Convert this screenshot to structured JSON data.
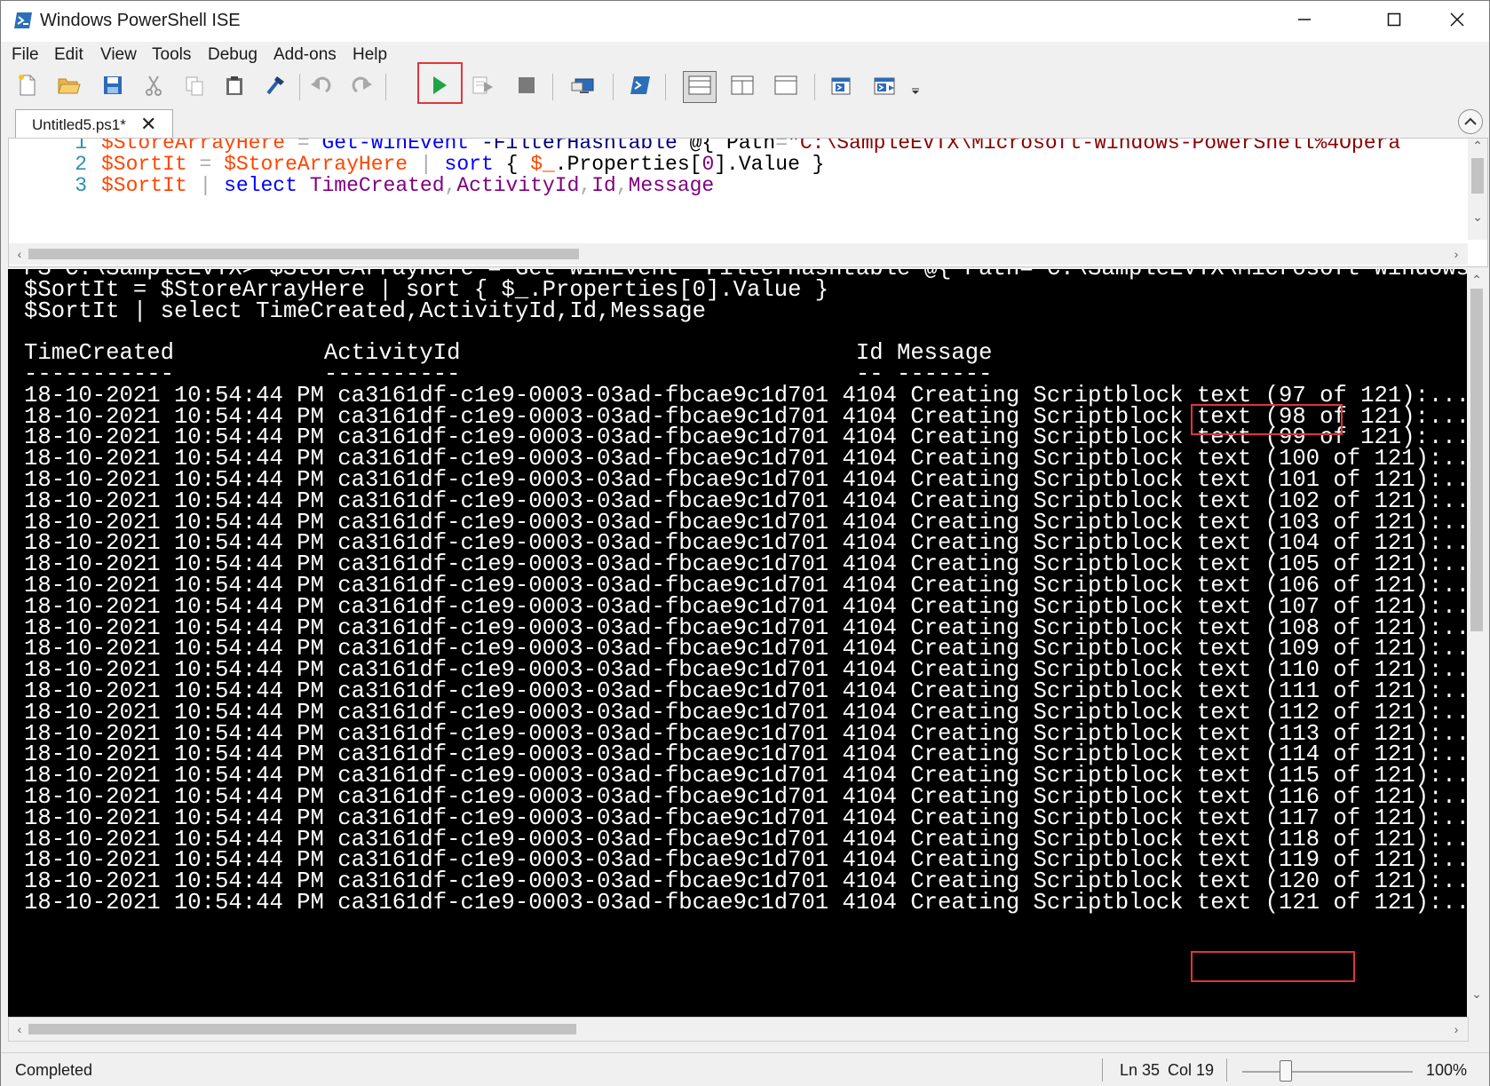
{
  "window": {
    "title": "Windows PowerShell ISE",
    "icons": [
      "powershell-icon",
      "minimize-icon",
      "maximize-icon",
      "close-icon"
    ]
  },
  "menu": [
    "File",
    "Edit",
    "View",
    "Tools",
    "Debug",
    "Add-ons",
    "Help"
  ],
  "toolbar": {
    "buttons": [
      "new-icon",
      "open-icon",
      "save-icon",
      "cut-icon",
      "copy-icon",
      "paste-icon",
      "clear-console-icon",
      "undo-icon",
      "redo-icon",
      "run-script-icon",
      "run-selection-icon",
      "stop-icon",
      "remote-powershell-icon",
      "powershell-console-icon",
      "script-pane-top-icon",
      "script-pane-right-icon",
      "script-pane-maximized-icon",
      "show-command-window-icon",
      "show-command-addon-icon",
      "toolbar-overflow-icon"
    ],
    "highlight_color": "#e0353a"
  },
  "tabs": [
    {
      "label": "Untitled5.ps1*",
      "active": true
    }
  ],
  "script": {
    "lines": [
      {
        "number": "1",
        "tokens": [
          {
            "t": "$StoreArrayHere",
            "k": "v"
          },
          {
            "t": " ",
            "k": "d"
          },
          {
            "t": "=",
            "k": "o"
          },
          {
            "t": " ",
            "k": "d"
          },
          {
            "t": "Get-WinEvent",
            "k": "c"
          },
          {
            "t": " ",
            "k": "d"
          },
          {
            "t": "-FilterHashtable",
            "k": "p"
          },
          {
            "t": " ",
            "k": "d"
          },
          {
            "t": "@{",
            "k": "d"
          },
          {
            "t": " Path",
            "k": "d"
          },
          {
            "t": "=",
            "k": "o"
          },
          {
            "t": "\"C:\\SampleEVTX\\Microsoft-Windows-PowerShell%4Opera",
            "k": "s"
          }
        ]
      },
      {
        "number": "2",
        "tokens": [
          {
            "t": "$SortIt",
            "k": "v"
          },
          {
            "t": " ",
            "k": "d"
          },
          {
            "t": "=",
            "k": "o"
          },
          {
            "t": " ",
            "k": "d"
          },
          {
            "t": "$StoreArrayHere",
            "k": "v"
          },
          {
            "t": " ",
            "k": "d"
          },
          {
            "t": "|",
            "k": "o"
          },
          {
            "t": " ",
            "k": "d"
          },
          {
            "t": "sort",
            "k": "c"
          },
          {
            "t": " { ",
            "k": "d"
          },
          {
            "t": "$_",
            "k": "v"
          },
          {
            "t": ".Properties[",
            "k": "d"
          },
          {
            "t": "0",
            "k": "n"
          },
          {
            "t": "].Value }",
            "k": "d"
          }
        ]
      },
      {
        "number": "3",
        "tokens": [
          {
            "t": "$SortIt",
            "k": "v"
          },
          {
            "t": " ",
            "k": "d"
          },
          {
            "t": "|",
            "k": "o"
          },
          {
            "t": " ",
            "k": "d"
          },
          {
            "t": "select",
            "k": "c"
          },
          {
            "t": " ",
            "k": "d"
          },
          {
            "t": "TimeCreated",
            "k": "n"
          },
          {
            "t": ",",
            "k": "o"
          },
          {
            "t": "ActivityId",
            "k": "n"
          },
          {
            "t": ",",
            "k": "o"
          },
          {
            "t": "Id",
            "k": "n"
          },
          {
            "t": ",",
            "k": "o"
          },
          {
            "t": "Message",
            "k": "n"
          }
        ]
      }
    ]
  },
  "console": {
    "lines": [
      "PS C:\\SampleEVTX> $StoreArrayHere = Get-WinEvent -FilterHashtable @{ Path=\"C:\\SampleEVTX\\Microsoft-Windows-Power",
      "$SortIt = $StoreArrayHere | sort { $_.Properties[0].Value }",
      "$SortIt | select TimeCreated,ActivityId,Id,Message",
      "",
      "TimeCreated           ActivityId                             Id Message",
      "-----------           ----------                             -- -------",
      "18-10-2021 10:54:44 PM ca3161df-c1e9-0003-03ad-fbcae9c1d701 4104 Creating Scriptblock text (97 of 121):...",
      "18-10-2021 10:54:44 PM ca3161df-c1e9-0003-03ad-fbcae9c1d701 4104 Creating Scriptblock text (98 of 121):...",
      "18-10-2021 10:54:44 PM ca3161df-c1e9-0003-03ad-fbcae9c1d701 4104 Creating Scriptblock text (99 of 121):...",
      "18-10-2021 10:54:44 PM ca3161df-c1e9-0003-03ad-fbcae9c1d701 4104 Creating Scriptblock text (100 of 121):...",
      "18-10-2021 10:54:44 PM ca3161df-c1e9-0003-03ad-fbcae9c1d701 4104 Creating Scriptblock text (101 of 121):...",
      "18-10-2021 10:54:44 PM ca3161df-c1e9-0003-03ad-fbcae9c1d701 4104 Creating Scriptblock text (102 of 121):...",
      "18-10-2021 10:54:44 PM ca3161df-c1e9-0003-03ad-fbcae9c1d701 4104 Creating Scriptblock text (103 of 121):...",
      "18-10-2021 10:54:44 PM ca3161df-c1e9-0003-03ad-fbcae9c1d701 4104 Creating Scriptblock text (104 of 121):...",
      "18-10-2021 10:54:44 PM ca3161df-c1e9-0003-03ad-fbcae9c1d701 4104 Creating Scriptblock text (105 of 121):...",
      "18-10-2021 10:54:44 PM ca3161df-c1e9-0003-03ad-fbcae9c1d701 4104 Creating Scriptblock text (106 of 121):...",
      "18-10-2021 10:54:44 PM ca3161df-c1e9-0003-03ad-fbcae9c1d701 4104 Creating Scriptblock text (107 of 121):...",
      "18-10-2021 10:54:44 PM ca3161df-c1e9-0003-03ad-fbcae9c1d701 4104 Creating Scriptblock text (108 of 121):...",
      "18-10-2021 10:54:44 PM ca3161df-c1e9-0003-03ad-fbcae9c1d701 4104 Creating Scriptblock text (109 of 121):...",
      "18-10-2021 10:54:44 PM ca3161df-c1e9-0003-03ad-fbcae9c1d701 4104 Creating Scriptblock text (110 of 121):...",
      "18-10-2021 10:54:44 PM ca3161df-c1e9-0003-03ad-fbcae9c1d701 4104 Creating Scriptblock text (111 of 121):...",
      "18-10-2021 10:54:44 PM ca3161df-c1e9-0003-03ad-fbcae9c1d701 4104 Creating Scriptblock text (112 of 121):...",
      "18-10-2021 10:54:44 PM ca3161df-c1e9-0003-03ad-fbcae9c1d701 4104 Creating Scriptblock text (113 of 121):...",
      "18-10-2021 10:54:44 PM ca3161df-c1e9-0003-03ad-fbcae9c1d701 4104 Creating Scriptblock text (114 of 121):...",
      "18-10-2021 10:54:44 PM ca3161df-c1e9-0003-03ad-fbcae9c1d701 4104 Creating Scriptblock text (115 of 121):...",
      "18-10-2021 10:54:44 PM ca3161df-c1e9-0003-03ad-fbcae9c1d701 4104 Creating Scriptblock text (116 of 121):...",
      "18-10-2021 10:54:44 PM ca3161df-c1e9-0003-03ad-fbcae9c1d701 4104 Creating Scriptblock text (117 of 121):...",
      "18-10-2021 10:54:44 PM ca3161df-c1e9-0003-03ad-fbcae9c1d701 4104 Creating Scriptblock text (118 of 121):...",
      "18-10-2021 10:54:44 PM ca3161df-c1e9-0003-03ad-fbcae9c1d701 4104 Creating Scriptblock text (119 of 121):...",
      "18-10-2021 10:54:44 PM ca3161df-c1e9-0003-03ad-fbcae9c1d701 4104 Creating Scriptblock text (120 of 121):...",
      "18-10-2021 10:54:44 PM ca3161df-c1e9-0003-03ad-fbcae9c1d701 4104 Creating Scriptblock text (121 of 121):..."
    ],
    "background": "#000000",
    "foreground": "#ffffff"
  },
  "status": {
    "text": "Completed",
    "line": "Ln 35",
    "col": "Col 19",
    "zoom": "100%",
    "zoom_level": 0.25
  }
}
